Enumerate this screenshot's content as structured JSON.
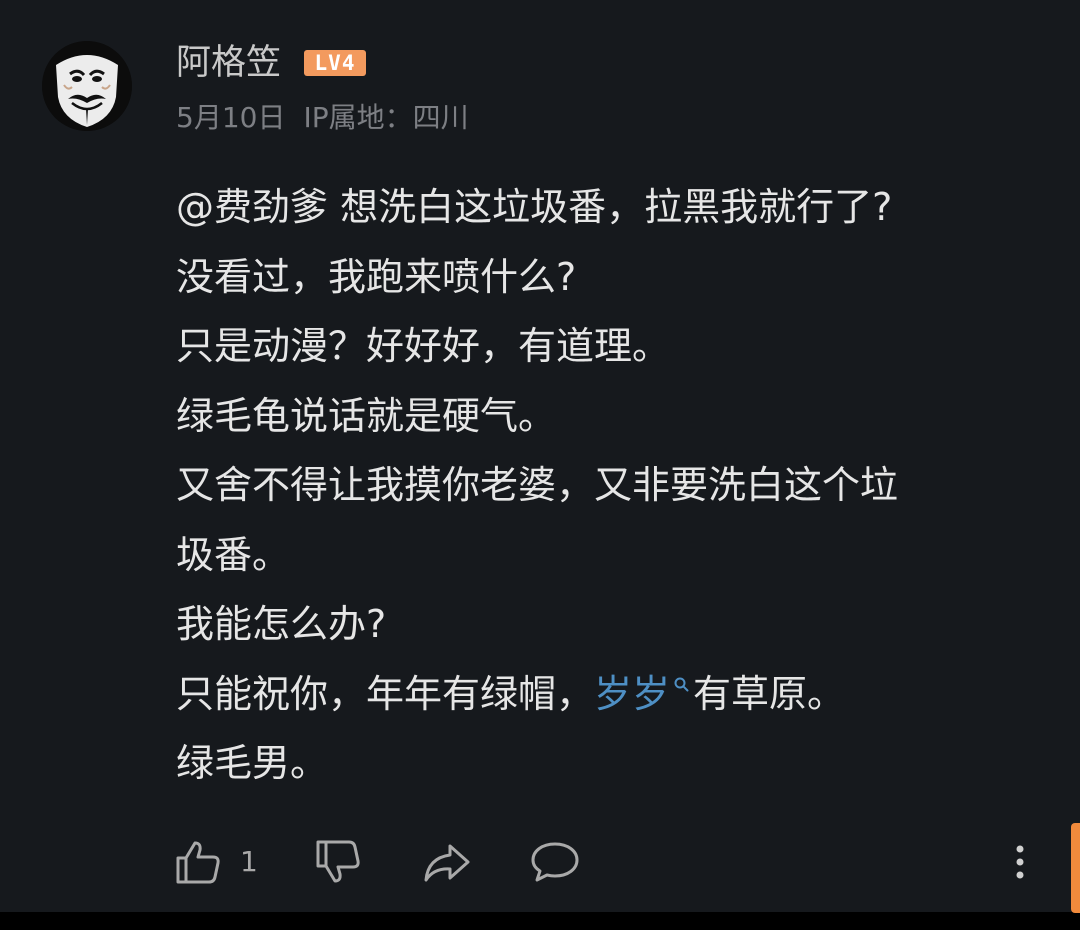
{
  "comment": {
    "author": {
      "name": "阿格笠",
      "level_badge": "LV4",
      "avatar_icon": "guy-fawkes-mask-avatar"
    },
    "meta": {
      "date": "5月10日",
      "ip_location": "IP属地：四川"
    },
    "body": {
      "line1": "@费劲爹 想洗白这垃圾番，拉黑我就行了?",
      "line2": "没看过，我跑来喷什么?",
      "line3": "只是动漫？好好好，有道理。",
      "line4": "绿毛龟说话就是硬气。",
      "line5": "又舍不得让我摸你老婆，又非要洗白这个垃",
      "line6": "圾番。",
      "line7": "我能怎么办?",
      "line8_before": "只能祝你，年年有绿帽，",
      "line8_link": "岁岁",
      "line8_after": "有草原。",
      "line9": "绿毛男。"
    },
    "actions": {
      "like_icon": "thumbs-up-icon",
      "like_count": "1",
      "dislike_icon": "thumbs-down-icon",
      "share_icon": "share-arrow-icon",
      "reply_icon": "chat-bubble-icon",
      "more_icon": "more-vertical-icon"
    },
    "colors": {
      "background": "#16191d",
      "text": "#e6e6e6",
      "meta_text": "#7d7f84",
      "link": "#4e8fc4",
      "level_badge": "#f39a5e",
      "scroll_accent": "#f08a3c"
    }
  }
}
